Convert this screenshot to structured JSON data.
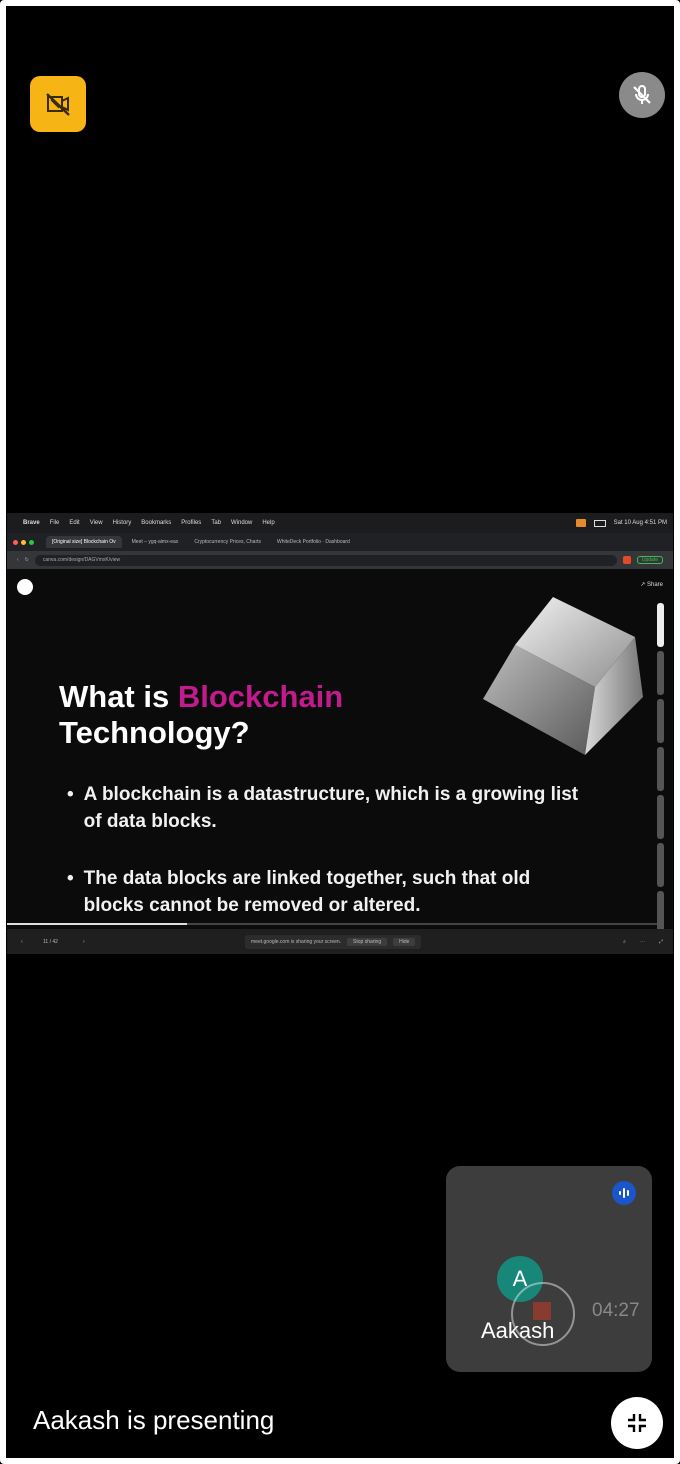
{
  "controls": {
    "screen_off_icon": "camera-off-icon",
    "mic_off_icon": "mic-off-icon",
    "exit_fullscreen_icon": "collapse-icon",
    "screen_off_color": "#f6b514"
  },
  "shared_screen": {
    "menubar": {
      "apple": "",
      "items": [
        "Brave",
        "File",
        "Edit",
        "View",
        "History",
        "Bookmarks",
        "Profiles",
        "Tab",
        "Window",
        "Help"
      ],
      "clock": "Sat 10 Aug 4:51 PM"
    },
    "tabs": [
      "[Original size] Blockchain Ov",
      "Meet – ygq-aimx-eax",
      "Cryptocurrency Prices, Charts",
      "WhiteDeck Portfolio · Dashboard"
    ],
    "url": "canva.com/design/DAGVmxK/view",
    "slide": {
      "title_prefix": "What is ",
      "title_accent": "Blockchain",
      "title_suffix": "Technology?",
      "accent_color": "#c21b8e",
      "bullets": [
        "A blockchain is a datastructure, which is a growing list of data blocks.",
        "The data blocks are linked together, such that old blocks cannot be removed or altered."
      ],
      "share_label": "Share"
    },
    "bottom_bar": {
      "page_counter": "11 / 42",
      "share_notice": "meet.google.com is sharing your screen.",
      "stop_sharing": "Stop sharing",
      "hide": "Hide"
    }
  },
  "self_view": {
    "avatar_letter": "A",
    "name": "Aakash",
    "avatar_color": "#17877a",
    "speaking_icon": "audio-wave-icon"
  },
  "recording": {
    "time": "04:27"
  },
  "footer": {
    "presenting_text": "Aakash is presenting"
  }
}
